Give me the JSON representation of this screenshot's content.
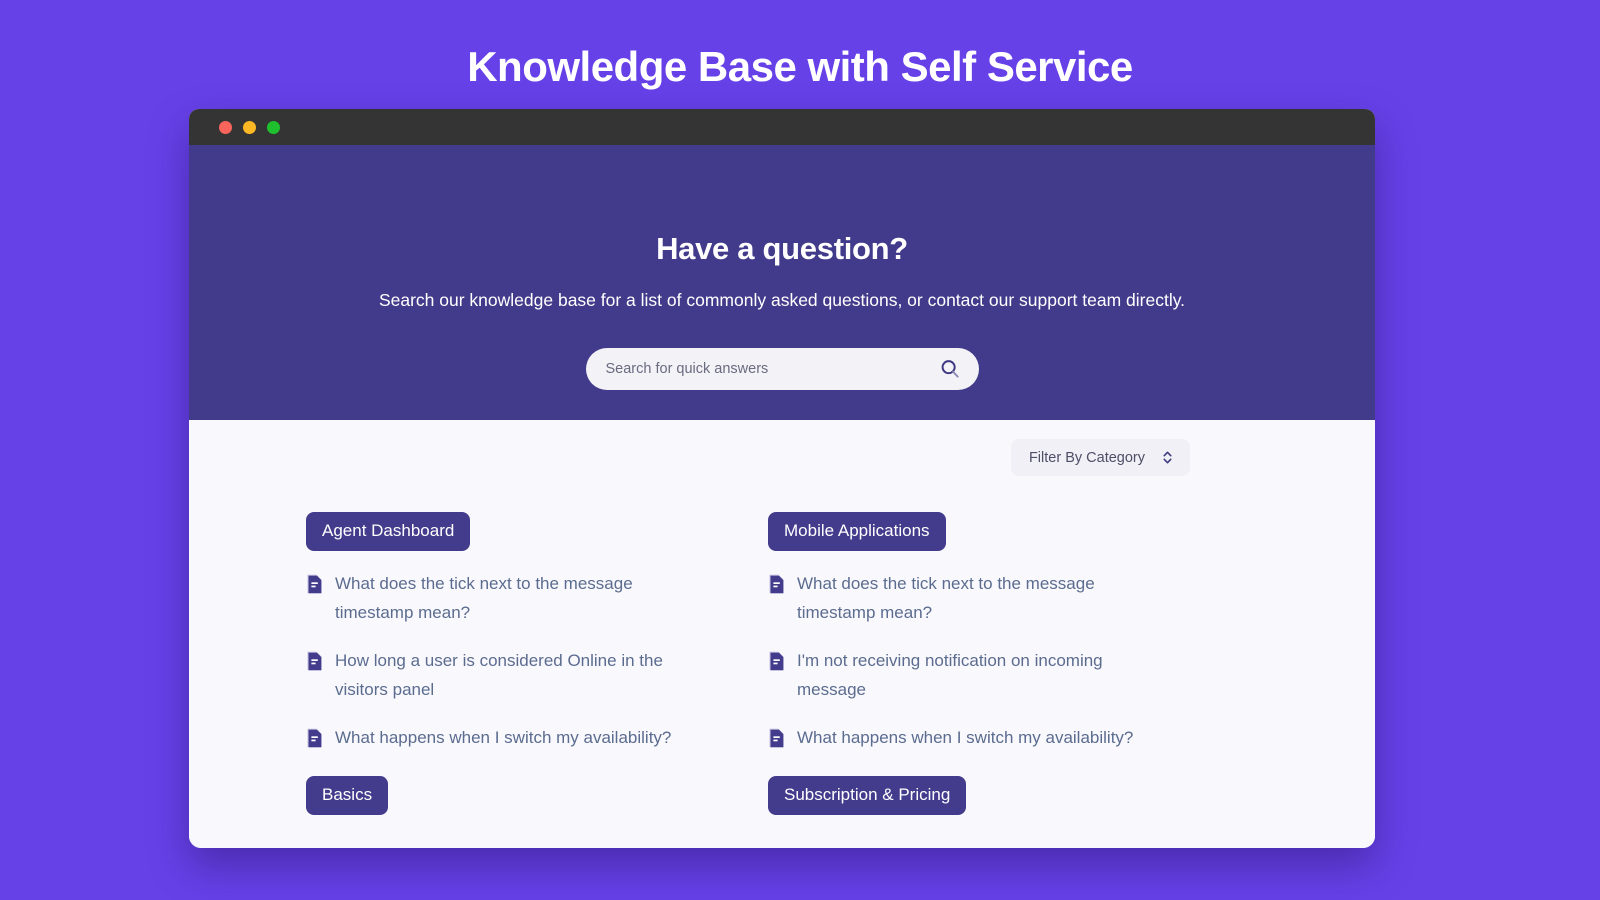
{
  "page": {
    "title": "Knowledge Base with Self Service",
    "background_color": "#6641e8"
  },
  "browser": {
    "traffic_lights": [
      {
        "name": "close",
        "color": "#f9655b"
      },
      {
        "name": "minimize",
        "color": "#fcb724"
      },
      {
        "name": "maximize",
        "color": "#1fc02d"
      }
    ]
  },
  "hero": {
    "background_color": "#423b8b",
    "heading": "Have a question?",
    "subtitle": "Search our knowledge base for a list of commonly asked questions, or contact our support team directly.",
    "search": {
      "placeholder": "Search for quick answers",
      "value": "",
      "icon": "search-icon"
    }
  },
  "content": {
    "background_color": "#f9f8fd",
    "filter": {
      "label": "Filter By Category",
      "icon": "chevron-up-down-icon"
    },
    "accent_color": "#433c8c",
    "link_color": "#5b6c8f",
    "categories": [
      {
        "name": "Agent Dashboard",
        "articles": [
          {
            "icon": "document-icon",
            "title": "What does the tick next to the message timestamp mean?"
          },
          {
            "icon": "document-icon",
            "title": "How long a user is considered Online in the visitors panel"
          },
          {
            "icon": "document-icon",
            "title": "What happens when I switch my availability?"
          }
        ]
      },
      {
        "name": "Mobile Applications",
        "articles": [
          {
            "icon": "document-icon",
            "title": "What does the tick next to the message timestamp mean?"
          },
          {
            "icon": "document-icon",
            "title": "I'm not receiving notification on incoming message"
          },
          {
            "icon": "document-icon",
            "title": "What happens when I switch my availability?"
          }
        ]
      }
    ],
    "categories_row2": [
      {
        "name": "Basics"
      },
      {
        "name": "Subscription & Pricing"
      }
    ]
  }
}
